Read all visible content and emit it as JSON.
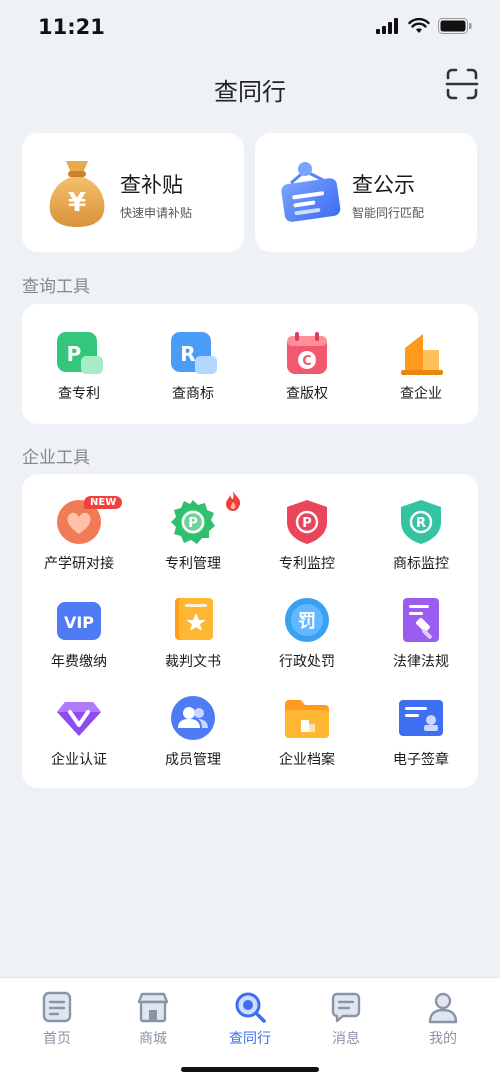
{
  "status_bar": {
    "time": "11:21"
  },
  "header": {
    "title": "查同行",
    "scan_icon": "scan-icon"
  },
  "top_cards": [
    {
      "title": "查补贴",
      "subtitle": "快速申请补贴",
      "icon": "money-bag-icon"
    },
    {
      "title": "查公示",
      "subtitle": "智能同行匹配",
      "icon": "notice-board-icon"
    }
  ],
  "query_tools": {
    "label": "查询工具",
    "items": [
      {
        "label": "查专利",
        "icon": "patent-icon"
      },
      {
        "label": "查商标",
        "icon": "trademark-icon"
      },
      {
        "label": "查版权",
        "icon": "copyright-icon"
      },
      {
        "label": "查企业",
        "icon": "enterprise-icon"
      }
    ]
  },
  "enterprise_tools": {
    "label": "企业工具",
    "badge_new": "NEW",
    "items": [
      {
        "label": "产学研对接",
        "icon": "heart-handshake-icon"
      },
      {
        "label": "专利管理",
        "icon": "patent-gear-icon"
      },
      {
        "label": "专利监控",
        "icon": "patent-shield-icon"
      },
      {
        "label": "商标监控",
        "icon": "trademark-shield-icon"
      },
      {
        "label": "年费缴纳",
        "icon": "vip-icon"
      },
      {
        "label": "裁判文书",
        "icon": "judgment-doc-icon"
      },
      {
        "label": "行政处罚",
        "icon": "penalty-icon"
      },
      {
        "label": "法律法规",
        "icon": "law-gavel-icon"
      },
      {
        "label": "企业认证",
        "icon": "verified-v-icon"
      },
      {
        "label": "成员管理",
        "icon": "members-icon"
      },
      {
        "label": "企业档案",
        "icon": "folder-archive-icon"
      },
      {
        "label": "电子签章",
        "icon": "e-seal-icon"
      }
    ]
  },
  "tabbar": [
    {
      "label": "首页",
      "icon": "home-doc-icon",
      "active": false
    },
    {
      "label": "商城",
      "icon": "store-icon",
      "active": false
    },
    {
      "label": "查同行",
      "icon": "search-icon",
      "active": true
    },
    {
      "label": "消息",
      "icon": "message-icon",
      "active": false
    },
    {
      "label": "我的",
      "icon": "profile-icon",
      "active": false
    }
  ],
  "colors": {
    "background": "#eef1f6",
    "accent": "#3b6ff0",
    "tab_inactive": "#8a94a6",
    "section_label": "#888888"
  }
}
